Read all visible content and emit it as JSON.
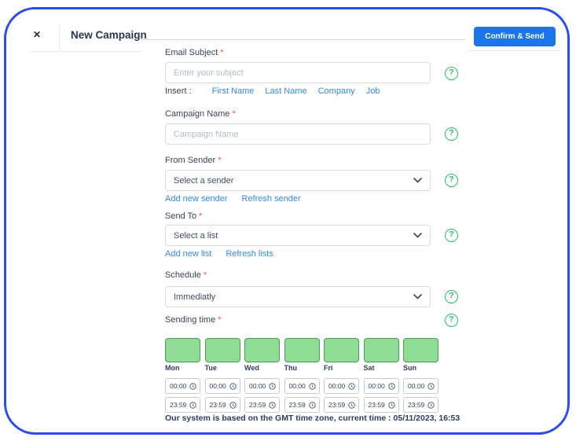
{
  "header": {
    "close_label": "✕",
    "title": "New Campaign",
    "confirm_button": "Confirm & Send"
  },
  "form": {
    "email_subject": {
      "label": "Email Subject",
      "required_mark": "*",
      "placeholder": "Enter your subject"
    },
    "insert": {
      "label": "Insert :",
      "links": [
        "First Name",
        "Last Name",
        "Company",
        "Job"
      ]
    },
    "campaign_name": {
      "label": "Campaign Name",
      "required_mark": "*",
      "placeholder": "Campaign Name"
    },
    "from_sender": {
      "label": "From Sender",
      "required_mark": "*",
      "value": "Select a sender",
      "links": [
        "Add new sender",
        "Refresh sender"
      ]
    },
    "send_to": {
      "label": "Send To",
      "required_mark": "*",
      "value": "Select a list",
      "links": [
        "Add new list",
        "Refresh lists"
      ]
    },
    "schedule": {
      "label": "Schedule",
      "required_mark": "*",
      "value": "Immediatly"
    },
    "sending_time": {
      "label": "Sending time",
      "required_mark": "*",
      "days": [
        {
          "name": "Mon",
          "start": "00:00",
          "end": "23:59"
        },
        {
          "name": "Tue",
          "start": "00:00",
          "end": "23:59"
        },
        {
          "name": "Wed",
          "start": "00:00",
          "end": "23:59"
        },
        {
          "name": "Thu",
          "start": "00:00",
          "end": "23:59"
        },
        {
          "name": "Fri",
          "start": "00:00",
          "end": "23:59"
        },
        {
          "name": "Sat",
          "start": "00:00",
          "end": "23:59"
        },
        {
          "name": "Sun",
          "start": "00:00",
          "end": "23:59"
        }
      ],
      "footer": "Our system is based on the GMT time zone, current time : 05/11/2023, 16:53"
    }
  },
  "colors": {
    "frame_border": "#2b4cf2",
    "primary_button": "#1b76ec",
    "help_icon_green": "#2abf5f",
    "link_blue": "#3787f3",
    "day_box_fill": "#8edc95",
    "day_box_border": "#4f9a59",
    "required_red": "#f4503a"
  }
}
